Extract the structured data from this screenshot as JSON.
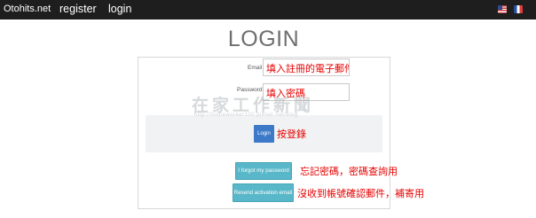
{
  "nav": {
    "brand": "Otohits.net",
    "register": "register",
    "login": "login",
    "flags": [
      "us-flag-icon",
      "fr-flag-icon"
    ]
  },
  "page": {
    "title": "LOGIN"
  },
  "form": {
    "email_label": "Email",
    "email_value": "填入註冊的電子郵件",
    "password_label": "Password",
    "password_value": "填入密碼",
    "login_button": "Login",
    "forgot_button": "I forgot my password",
    "resend_button": "Resend activation email"
  },
  "annotations": {
    "login": "按登錄",
    "forgot": "忘記密碼，密碼查詢用",
    "resend": "沒收到帳號確認郵件，補寄用"
  },
  "watermark": {
    "text": "在家工作新聞",
    "url": "http://homeworker100.pixnet.net/blog"
  },
  "colors": {
    "navbar": "#1e1e1e",
    "login_button": "#3c79c8",
    "teal_button": "#58b7c8",
    "annotation": "#e60000"
  }
}
